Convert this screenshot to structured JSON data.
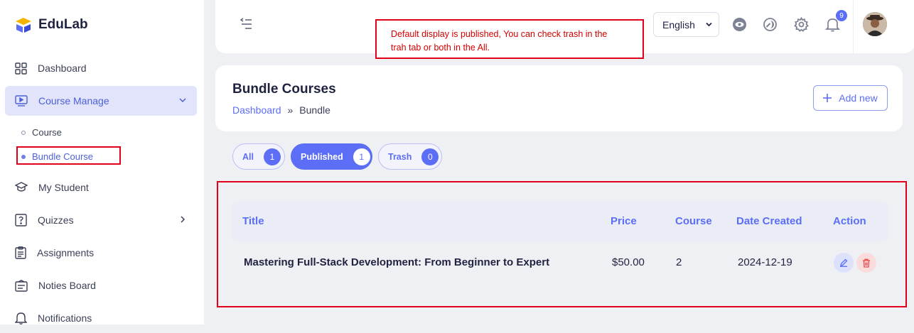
{
  "brand": {
    "name": "EduLab"
  },
  "sidebar": {
    "items": [
      {
        "label": "Dashboard",
        "icon": "grid-icon"
      },
      {
        "label": "Course Manage",
        "icon": "video-icon"
      },
      {
        "label": "My Student",
        "icon": "graduation-icon"
      },
      {
        "label": "Quizzes",
        "icon": "quiz-icon"
      },
      {
        "label": "Assignments",
        "icon": "assignment-icon"
      },
      {
        "label": "Noties Board",
        "icon": "board-icon"
      },
      {
        "label": "Notifications",
        "icon": "bell-icon"
      }
    ],
    "subitems": [
      {
        "label": "Course"
      },
      {
        "label": "Bundle Course"
      }
    ]
  },
  "annotation": {
    "line1": "Default display is published, You can check trash in the",
    "line2": "trah tab or both in the All."
  },
  "topbar": {
    "language": "English",
    "notification_count": "9"
  },
  "page": {
    "title": "Bundle Courses",
    "breadcrumb": [
      "Dashboard",
      "»",
      "Bundle"
    ],
    "add_new_label": "Add new"
  },
  "tabs": [
    {
      "label": "All",
      "count": "1"
    },
    {
      "label": "Published",
      "count": "1"
    },
    {
      "label": "Trash",
      "count": "0"
    }
  ],
  "table": {
    "headers": [
      "Title",
      "Price",
      "Course",
      "Date Created",
      "Action"
    ],
    "rows": [
      {
        "title": "Mastering Full-Stack Development: From Beginner to Expert",
        "price": "$50.00",
        "course": "2",
        "date": "2024-12-19"
      }
    ]
  },
  "colors": {
    "accent": "#5b6ef5",
    "highlight": "#e0001a"
  }
}
